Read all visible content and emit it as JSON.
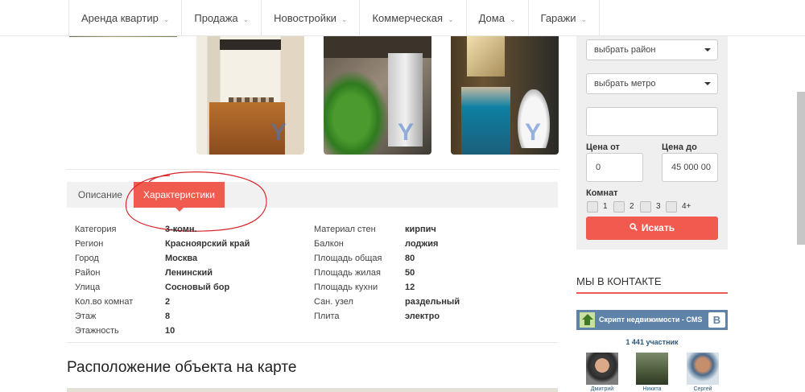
{
  "nav": {
    "items": [
      {
        "label": "Аренда квартир",
        "caret": "⌄"
      },
      {
        "label": "Продажа",
        "caret": "⌄"
      },
      {
        "label": "Новостройки",
        "caret": "⌄"
      },
      {
        "label": "Коммерческая",
        "caret": "⌄"
      },
      {
        "label": "Дома",
        "caret": "⌄"
      },
      {
        "label": "Гаражи",
        "caret": "⌄"
      }
    ]
  },
  "gallery": {
    "watermark": "Y"
  },
  "tabs": {
    "description": "Описание",
    "characteristics": "Характеристики"
  },
  "props_left": [
    {
      "key": "Категория",
      "value": "3-комн."
    },
    {
      "key": "Регион",
      "value": "Красноярский край"
    },
    {
      "key": "Город",
      "value": "Москва"
    },
    {
      "key": "Район",
      "value": "Ленинский"
    },
    {
      "key": "Улица",
      "value": "Сосновый бор"
    },
    {
      "key": "Кол.во комнат",
      "value": "2"
    },
    {
      "key": "Этаж",
      "value": "8"
    },
    {
      "key": "Этажность",
      "value": "10"
    }
  ],
  "props_right": [
    {
      "key": "Материал стен",
      "value": "кирпич"
    },
    {
      "key": "Балкон",
      "value": "лоджия"
    },
    {
      "key": "Площадь общая",
      "value": "80"
    },
    {
      "key": "Площадь жилая",
      "value": "50"
    },
    {
      "key": "Площадь кухни",
      "value": "12"
    },
    {
      "key": "Сан. узел",
      "value": "раздельный"
    },
    {
      "key": "Плита",
      "value": "электро"
    }
  ],
  "map": {
    "title": "Расположение объекта на карте"
  },
  "search": {
    "district_placeholder": "выбрать район",
    "metro_placeholder": "выбрать метро",
    "keyword_value": "",
    "price_from_label": "Цена от",
    "price_to_label": "Цена до",
    "price_from_value": "0",
    "price_to_value": "45 000 00",
    "rooms_label": "Комнат",
    "rooms": [
      "1",
      "2",
      "3",
      "4+"
    ],
    "button_label": "Искать",
    "button_icon": "search-icon"
  },
  "vk": {
    "title": "МЫ В КОНТАКТЕ",
    "group_name": "Скрипт недвижимости - CMS",
    "badge": "B",
    "members": "1 441 участник",
    "people": [
      "Дмитрий",
      "Никита",
      "Сергей"
    ]
  },
  "colors": {
    "accent": "#f05a4f",
    "vk_blue": "#5e82a8"
  }
}
